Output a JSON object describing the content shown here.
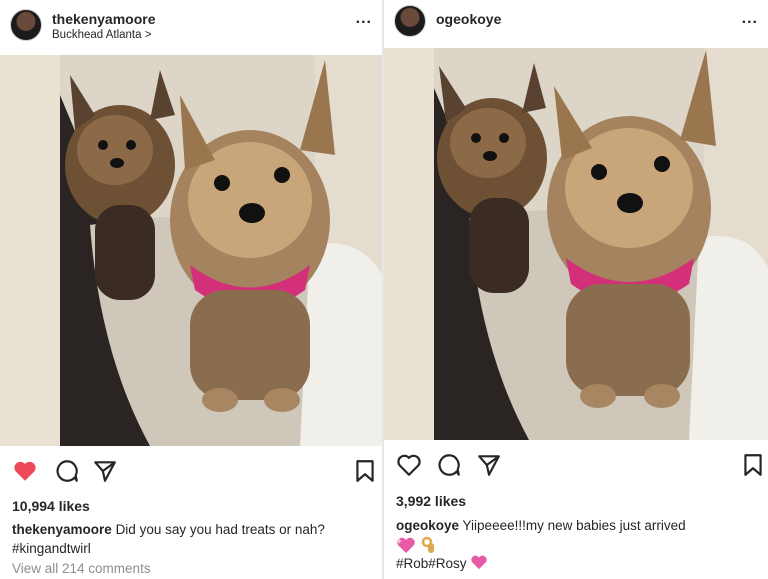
{
  "left_post": {
    "username": "thekenyamoore",
    "location": "Buckhead Atlanta >",
    "more_label": "...",
    "liked": true,
    "likes": "10,994 likes",
    "caption_user": "thekenyamoore",
    "caption_text": "Did you say you had treats or nah?",
    "hashtags": "#kingandtwirl",
    "comments_link": "View all 214 comments",
    "icons": [
      "heart-filled-icon",
      "comment-icon",
      "share-icon",
      "bookmark-icon"
    ],
    "colors": {
      "heart": "#ed4956"
    }
  },
  "right_post": {
    "username": "ogeokoye",
    "more_label": "...",
    "liked": false,
    "likes": "3,992 likes",
    "caption_user": "ogeokoye",
    "caption_text": "Yiipeeee!!!my new babies just arrived",
    "hashtags": "#Rob#Rosy",
    "icons": [
      "heart-outline-icon",
      "comment-icon",
      "share-icon",
      "bookmark-icon",
      "sparkling-heart-emoji",
      "ok-hand-emoji"
    ],
    "colors": {
      "pink_emoji": "#e75aa8"
    }
  }
}
